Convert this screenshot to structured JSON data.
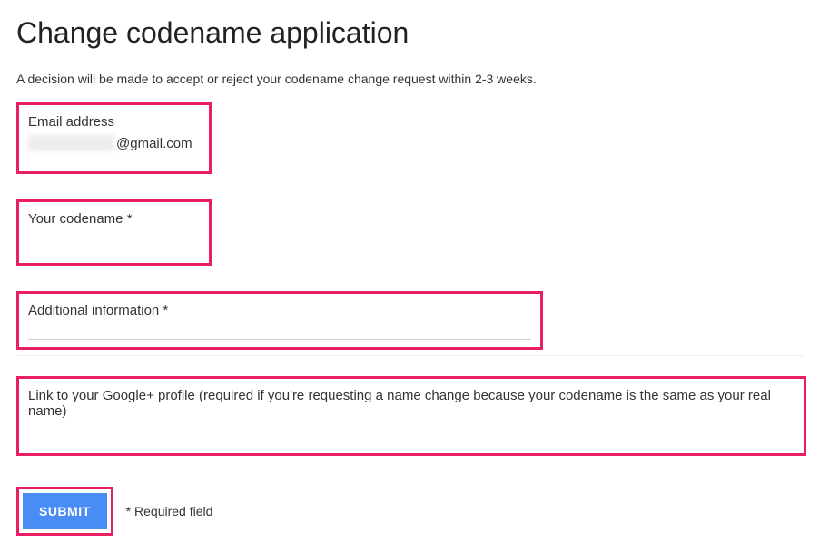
{
  "page": {
    "title": "Change codename application",
    "subtitle": "A decision will be made to accept or reject your codename change request within 2-3 weeks."
  },
  "fields": {
    "email": {
      "label": "Email address",
      "value_domain": "@gmail.com"
    },
    "codename": {
      "label": "Your codename *"
    },
    "additional": {
      "label": "Additional information *"
    },
    "gplus": {
      "label": "Link to your Google+ profile (required if you're requesting a name change because your codename is the same as your real name)"
    }
  },
  "actions": {
    "submit_label": "SUBMIT",
    "required_note": "* Required field"
  }
}
